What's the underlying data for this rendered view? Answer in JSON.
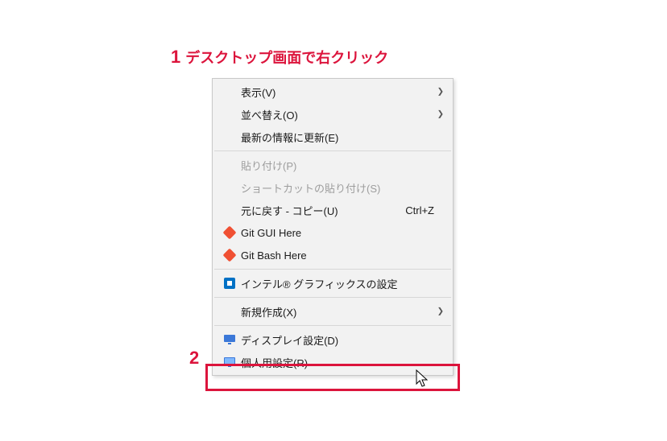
{
  "annotation": {
    "step1_num": "1",
    "step1_text": "デスクトップ画面で右クリック",
    "step2_num": "2"
  },
  "menu": {
    "view": {
      "label": "表示(V)",
      "has_submenu": true
    },
    "sort": {
      "label": "並べ替え(O)",
      "has_submenu": true
    },
    "refresh": {
      "label": "最新の情報に更新(E)"
    },
    "paste": {
      "label": "貼り付け(P)",
      "disabled": true
    },
    "paste_shortcut": {
      "label": "ショートカットの貼り付け(S)",
      "disabled": true
    },
    "undo": {
      "label": "元に戻す - コピー(U)",
      "shortcut": "Ctrl+Z"
    },
    "git_gui": {
      "label": "Git GUI Here",
      "icon": "git-red"
    },
    "git_bash": {
      "label": "Git Bash Here",
      "icon": "git-red"
    },
    "intel_gfx": {
      "label": "インテル® グラフィックスの設定",
      "icon": "intel-blue"
    },
    "new": {
      "label": "新規作成(X)",
      "has_submenu": true
    },
    "display": {
      "label": "ディスプレイ設定(D)",
      "icon": "monitor"
    },
    "personalize": {
      "label": "個人用設定(R)",
      "icon": "personalize"
    }
  },
  "colors": {
    "highlight": "#dc143c",
    "menu_bg": "#f2f2f2",
    "menu_border": "#c9c9c9"
  }
}
